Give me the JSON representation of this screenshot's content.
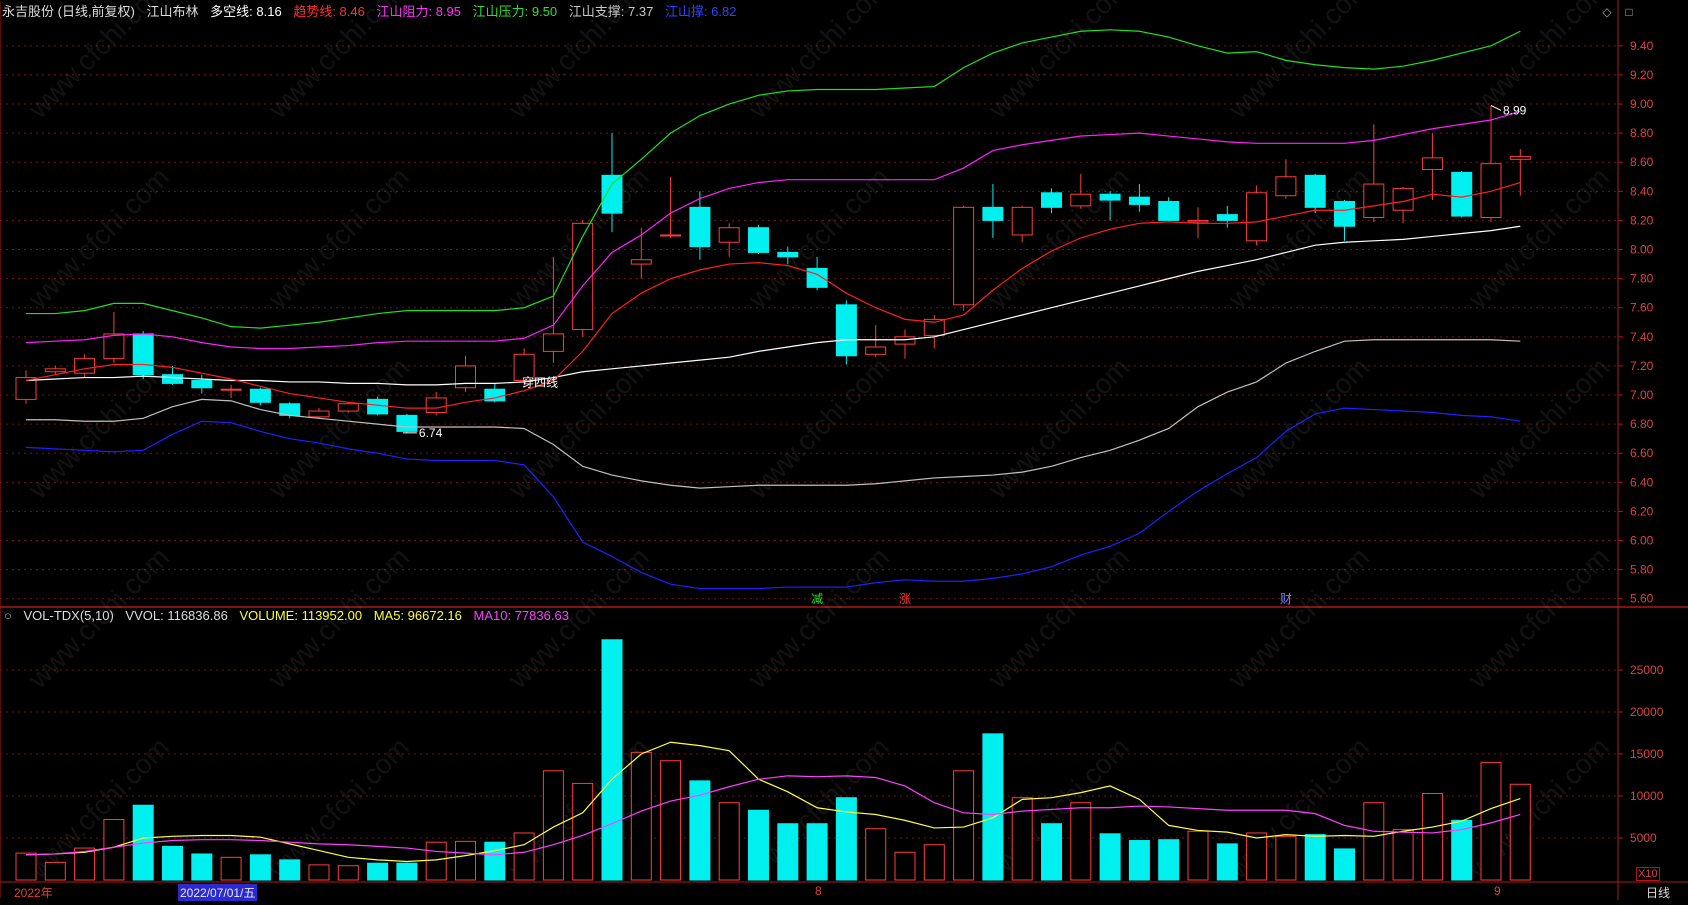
{
  "price_header": {
    "stock": "永吉股份 (日线,前复权)",
    "indicator": "江山布林",
    "duokong_label": "多空线: 8.16",
    "trend_label": "趋势线: 8.46",
    "resist_label": "江山阻力: 8.95",
    "pressure_label": "江山压力: 9.50",
    "support_label": "江山支撑: 7.37",
    "floor_label": "江山撑: 6.82"
  },
  "vol_header": {
    "name": "VOL-TDX(5,10)",
    "vvol": "VVOL: 116836.86",
    "volume": "VOLUME: 113952.00",
    "ma5": "MA5: 96672.16",
    "ma10": "MA10: 77836.63"
  },
  "footer": {
    "year": "2022年",
    "date": "2022/07/01/五",
    "month8": "8",
    "month9": "9",
    "period": "日线",
    "x10": "X10"
  },
  "annotations": {
    "high": "8.99",
    "low": "6.74",
    "cross4": "穿四线",
    "jian": "减",
    "zhang": "涨",
    "cai": "财"
  },
  "watermark": "www.cfchi.com",
  "chart_data": [
    {
      "type": "candlestick",
      "ylim": [
        5.55,
        9.55
      ],
      "yticks": [
        5.6,
        5.8,
        6.0,
        6.2,
        6.4,
        6.6,
        6.8,
        7.0,
        7.2,
        7.4,
        7.6,
        7.8,
        8.0,
        8.2,
        8.4,
        8.6,
        8.8,
        9.0,
        9.2,
        9.4
      ],
      "candles": [
        {
          "o": 6.97,
          "h": 7.17,
          "l": 6.94,
          "c": 7.12
        },
        {
          "o": 7.16,
          "h": 7.2,
          "l": 7.14,
          "c": 7.18
        },
        {
          "o": 7.15,
          "h": 7.28,
          "l": 7.12,
          "c": 7.25
        },
        {
          "o": 7.25,
          "h": 7.57,
          "l": 7.22,
          "c": 7.42
        },
        {
          "o": 7.42,
          "h": 7.44,
          "l": 7.11,
          "c": 7.14
        },
        {
          "o": 7.14,
          "h": 7.2,
          "l": 7.07,
          "c": 7.08
        },
        {
          "o": 7.1,
          "h": 7.14,
          "l": 7.01,
          "c": 7.05
        },
        {
          "o": 7.04,
          "h": 7.07,
          "l": 6.98,
          "c": 7.04
        },
        {
          "o": 7.04,
          "h": 7.05,
          "l": 6.93,
          "c": 6.95
        },
        {
          "o": 6.94,
          "h": 6.95,
          "l": 6.84,
          "c": 6.86
        },
        {
          "o": 6.85,
          "h": 6.91,
          "l": 6.84,
          "c": 6.89
        },
        {
          "o": 6.89,
          "h": 6.95,
          "l": 6.88,
          "c": 6.94
        },
        {
          "o": 6.97,
          "h": 6.99,
          "l": 6.86,
          "c": 6.87
        },
        {
          "o": 6.86,
          "h": 6.87,
          "l": 6.74,
          "c": 6.75
        },
        {
          "o": 6.88,
          "h": 7.02,
          "l": 6.86,
          "c": 6.98
        },
        {
          "o": 7.05,
          "h": 7.27,
          "l": 7.02,
          "c": 7.2
        },
        {
          "o": 7.04,
          "h": 7.08,
          "l": 6.95,
          "c": 6.96
        },
        {
          "o": 7.1,
          "h": 7.32,
          "l": 7.05,
          "c": 7.28
        },
        {
          "o": 7.3,
          "h": 7.95,
          "l": 7.22,
          "c": 7.42
        },
        {
          "o": 7.45,
          "h": 8.2,
          "l": 7.4,
          "c": 8.18
        },
        {
          "o": 8.51,
          "h": 8.8,
          "l": 8.12,
          "c": 8.25
        },
        {
          "o": 7.9,
          "h": 8.15,
          "l": 7.8,
          "c": 7.93
        },
        {
          "o": 8.1,
          "h": 8.5,
          "l": 8.08,
          "c": 8.1
        },
        {
          "o": 8.29,
          "h": 8.4,
          "l": 7.93,
          "c": 8.02
        },
        {
          "o": 8.05,
          "h": 8.18,
          "l": 7.95,
          "c": 8.15
        },
        {
          "o": 8.15,
          "h": 8.17,
          "l": 7.97,
          "c": 7.98
        },
        {
          "o": 7.98,
          "h": 8.02,
          "l": 7.9,
          "c": 7.95
        },
        {
          "o": 7.87,
          "h": 7.95,
          "l": 7.72,
          "c": 7.74
        },
        {
          "o": 7.62,
          "h": 7.65,
          "l": 7.21,
          "c": 7.27
        },
        {
          "o": 7.28,
          "h": 7.48,
          "l": 7.26,
          "c": 7.33
        },
        {
          "o": 7.35,
          "h": 7.45,
          "l": 7.25,
          "c": 7.4
        },
        {
          "o": 7.41,
          "h": 7.55,
          "l": 7.32,
          "c": 7.52
        },
        {
          "o": 7.62,
          "h": 8.3,
          "l": 7.58,
          "c": 8.29
        },
        {
          "o": 8.29,
          "h": 8.45,
          "l": 8.08,
          "c": 8.2
        },
        {
          "o": 8.1,
          "h": 8.3,
          "l": 8.05,
          "c": 8.29
        },
        {
          "o": 8.39,
          "h": 8.42,
          "l": 8.25,
          "c": 8.29
        },
        {
          "o": 8.3,
          "h": 8.52,
          "l": 8.28,
          "c": 8.38
        },
        {
          "o": 8.38,
          "h": 8.4,
          "l": 8.2,
          "c": 8.34
        },
        {
          "o": 8.36,
          "h": 8.45,
          "l": 8.26,
          "c": 8.31
        },
        {
          "o": 8.33,
          "h": 8.36,
          "l": 8.2,
          "c": 8.2
        },
        {
          "o": 8.19,
          "h": 8.29,
          "l": 8.08,
          "c": 8.2
        },
        {
          "o": 8.24,
          "h": 8.3,
          "l": 8.15,
          "c": 8.2
        },
        {
          "o": 8.06,
          "h": 8.44,
          "l": 8.03,
          "c": 8.39
        },
        {
          "o": 8.37,
          "h": 8.62,
          "l": 8.35,
          "c": 8.5
        },
        {
          "o": 8.51,
          "h": 8.52,
          "l": 8.25,
          "c": 8.29
        },
        {
          "o": 8.33,
          "h": 8.34,
          "l": 8.06,
          "c": 8.16
        },
        {
          "o": 8.22,
          "h": 8.86,
          "l": 8.19,
          "c": 8.45
        },
        {
          "o": 8.27,
          "h": 8.43,
          "l": 8.18,
          "c": 8.42
        },
        {
          "o": 8.55,
          "h": 8.8,
          "l": 8.34,
          "c": 8.63
        },
        {
          "o": 8.53,
          "h": 8.54,
          "l": 8.22,
          "c": 8.23
        },
        {
          "o": 8.22,
          "h": 8.99,
          "l": 8.19,
          "c": 8.59
        },
        {
          "o": 8.62,
          "h": 8.69,
          "l": 8.37,
          "c": 8.64
        }
      ],
      "series": [
        {
          "key": "duokong",
          "values": [
            7.1,
            7.11,
            7.12,
            7.12,
            7.13,
            7.12,
            7.11,
            7.1,
            7.1,
            7.09,
            7.09,
            7.08,
            7.08,
            7.07,
            7.07,
            7.08,
            7.08,
            7.09,
            7.12,
            7.16,
            7.18,
            7.2,
            7.22,
            7.24,
            7.26,
            7.3,
            7.33,
            7.36,
            7.38,
            7.38,
            7.38,
            7.4,
            7.45,
            7.5,
            7.55,
            7.6,
            7.65,
            7.7,
            7.75,
            7.8,
            7.85,
            7.89,
            7.93,
            7.98,
            8.03,
            8.05,
            8.06,
            8.07,
            8.09,
            8.11,
            8.13,
            8.16
          ]
        },
        {
          "key": "trend",
          "values": [
            7.1,
            7.14,
            7.18,
            7.21,
            7.21,
            7.19,
            7.15,
            7.11,
            7.06,
            7.01,
            6.98,
            6.95,
            6.93,
            6.91,
            6.91,
            6.95,
            6.98,
            7.03,
            7.1,
            7.3,
            7.56,
            7.7,
            7.8,
            7.86,
            7.9,
            7.91,
            7.89,
            7.83,
            7.7,
            7.6,
            7.52,
            7.5,
            7.55,
            7.72,
            7.87,
            7.99,
            8.08,
            8.14,
            8.18,
            8.19,
            8.18,
            8.18,
            8.19,
            8.23,
            8.27,
            8.27,
            8.3,
            8.33,
            8.38,
            8.36,
            8.4,
            8.46
          ]
        },
        {
          "key": "resist",
          "values": [
            7.36,
            7.37,
            7.38,
            7.41,
            7.42,
            7.4,
            7.36,
            7.33,
            7.32,
            7.32,
            7.33,
            7.34,
            7.36,
            7.37,
            7.37,
            7.37,
            7.37,
            7.39,
            7.48,
            7.75,
            7.98,
            8.1,
            8.25,
            8.35,
            8.42,
            8.46,
            8.48,
            8.48,
            8.48,
            8.48,
            8.48,
            8.48,
            8.56,
            8.68,
            8.72,
            8.75,
            8.78,
            8.79,
            8.8,
            8.78,
            8.76,
            8.74,
            8.73,
            8.73,
            8.73,
            8.73,
            8.75,
            8.79,
            8.83,
            8.86,
            8.89,
            8.95
          ]
        },
        {
          "key": "pressure",
          "values": [
            7.56,
            7.56,
            7.58,
            7.63,
            7.63,
            7.58,
            7.53,
            7.47,
            7.46,
            7.48,
            7.5,
            7.53,
            7.56,
            7.58,
            7.58,
            7.58,
            7.58,
            7.6,
            7.68,
            8.09,
            8.45,
            8.62,
            8.8,
            8.92,
            9.0,
            9.06,
            9.09,
            9.1,
            9.1,
            9.1,
            9.11,
            9.12,
            9.25,
            9.35,
            9.42,
            9.46,
            9.5,
            9.51,
            9.5,
            9.46,
            9.4,
            9.35,
            9.36,
            9.3,
            9.27,
            9.25,
            9.24,
            9.26,
            9.3,
            9.35,
            9.4,
            9.5
          ]
        },
        {
          "key": "support",
          "values": [
            6.83,
            6.83,
            6.82,
            6.82,
            6.84,
            6.92,
            6.97,
            6.96,
            6.9,
            6.86,
            6.84,
            6.82,
            6.8,
            6.78,
            6.78,
            6.78,
            6.78,
            6.77,
            6.66,
            6.51,
            6.45,
            6.41,
            6.38,
            6.36,
            6.37,
            6.38,
            6.38,
            6.38,
            6.38,
            6.39,
            6.41,
            6.43,
            6.44,
            6.45,
            6.47,
            6.51,
            6.57,
            6.62,
            6.69,
            6.77,
            6.92,
            7.02,
            7.09,
            7.22,
            7.3,
            7.37,
            7.38,
            7.38,
            7.38,
            7.38,
            7.38,
            7.37
          ]
        },
        {
          "key": "floor",
          "values": [
            6.64,
            6.63,
            6.62,
            6.61,
            6.62,
            6.73,
            6.82,
            6.81,
            6.75,
            6.7,
            6.67,
            6.63,
            6.6,
            6.56,
            6.55,
            6.55,
            6.55,
            6.52,
            6.3,
            5.99,
            5.89,
            5.78,
            5.7,
            5.67,
            5.67,
            5.67,
            5.68,
            5.68,
            5.68,
            5.71,
            5.73,
            5.72,
            5.72,
            5.74,
            5.77,
            5.82,
            5.9,
            5.96,
            6.05,
            6.2,
            6.34,
            6.46,
            6.57,
            6.75,
            6.87,
            6.91,
            6.9,
            6.89,
            6.88,
            6.86,
            6.85,
            6.82
          ]
        }
      ]
    },
    {
      "type": "bar",
      "ylim": [
        0,
        30000
      ],
      "yticks": [
        5000,
        10000,
        15000,
        20000,
        25000
      ],
      "volumes": [
        3200,
        2100,
        3800,
        7200,
        8900,
        4000,
        3100,
        2700,
        3000,
        2400,
        1800,
        1700,
        2000,
        2000,
        4500,
        4600,
        4500,
        5600,
        13000,
        11500,
        28600,
        15200,
        14200,
        11800,
        9200,
        8300,
        6700,
        6700,
        9800,
        6100,
        3300,
        4200,
        13000,
        17400,
        9800,
        6700,
        9200,
        5500,
        4700,
        4800,
        5800,
        4300,
        5600,
        5200,
        5400,
        3700,
        9200,
        6000,
        10300,
        7100,
        14000,
        11395
      ],
      "series": [
        {
          "key": "ma5",
          "values": [
            3000,
            3100,
            3300,
            3900,
            5000,
            5200,
            5300,
            5300,
            5100,
            4300,
            3500,
            2700,
            2400,
            2200,
            2400,
            2900,
            3500,
            4200,
            6300,
            8000,
            12000,
            15000,
            16400,
            16000,
            15400,
            12000,
            10500,
            8600,
            8100,
            7800,
            7100,
            6200,
            6300,
            7400,
            9600,
            9800,
            10400,
            11200,
            9600,
            6500,
            5900,
            5700,
            5000,
            5400,
            5200,
            5300,
            5200,
            5800,
            6300,
            7000,
            8500,
            9700
          ]
        },
        {
          "key": "ma10",
          "values": [
            3000,
            3100,
            3400,
            3900,
            4400,
            4700,
            4800,
            4800,
            4700,
            4500,
            4300,
            4200,
            4000,
            3800,
            3400,
            3200,
            3000,
            3300,
            4200,
            5300,
            6700,
            8200,
            9400,
            10100,
            11100,
            12000,
            12400,
            12300,
            12400,
            12200,
            11200,
            9200,
            8000,
            7800,
            8200,
            8400,
            8600,
            8600,
            8800,
            8700,
            8500,
            8300,
            8300,
            8300,
            7900,
            6500,
            5800,
            5700,
            5600,
            6000,
            6800,
            7800
          ]
        }
      ]
    }
  ],
  "colors": {
    "up": "#ff3c3c",
    "down": "#00f0f0",
    "duokong": "#ffffff",
    "trend": "#ff2020",
    "resist": "#ff20ff",
    "pressure": "#20e020",
    "support": "#c0c0c0",
    "floor": "#2020ff",
    "ma5": "#ffff40",
    "ma10": "#ff40ff",
    "grid": "#7a1010",
    "axis": "#b01818"
  }
}
